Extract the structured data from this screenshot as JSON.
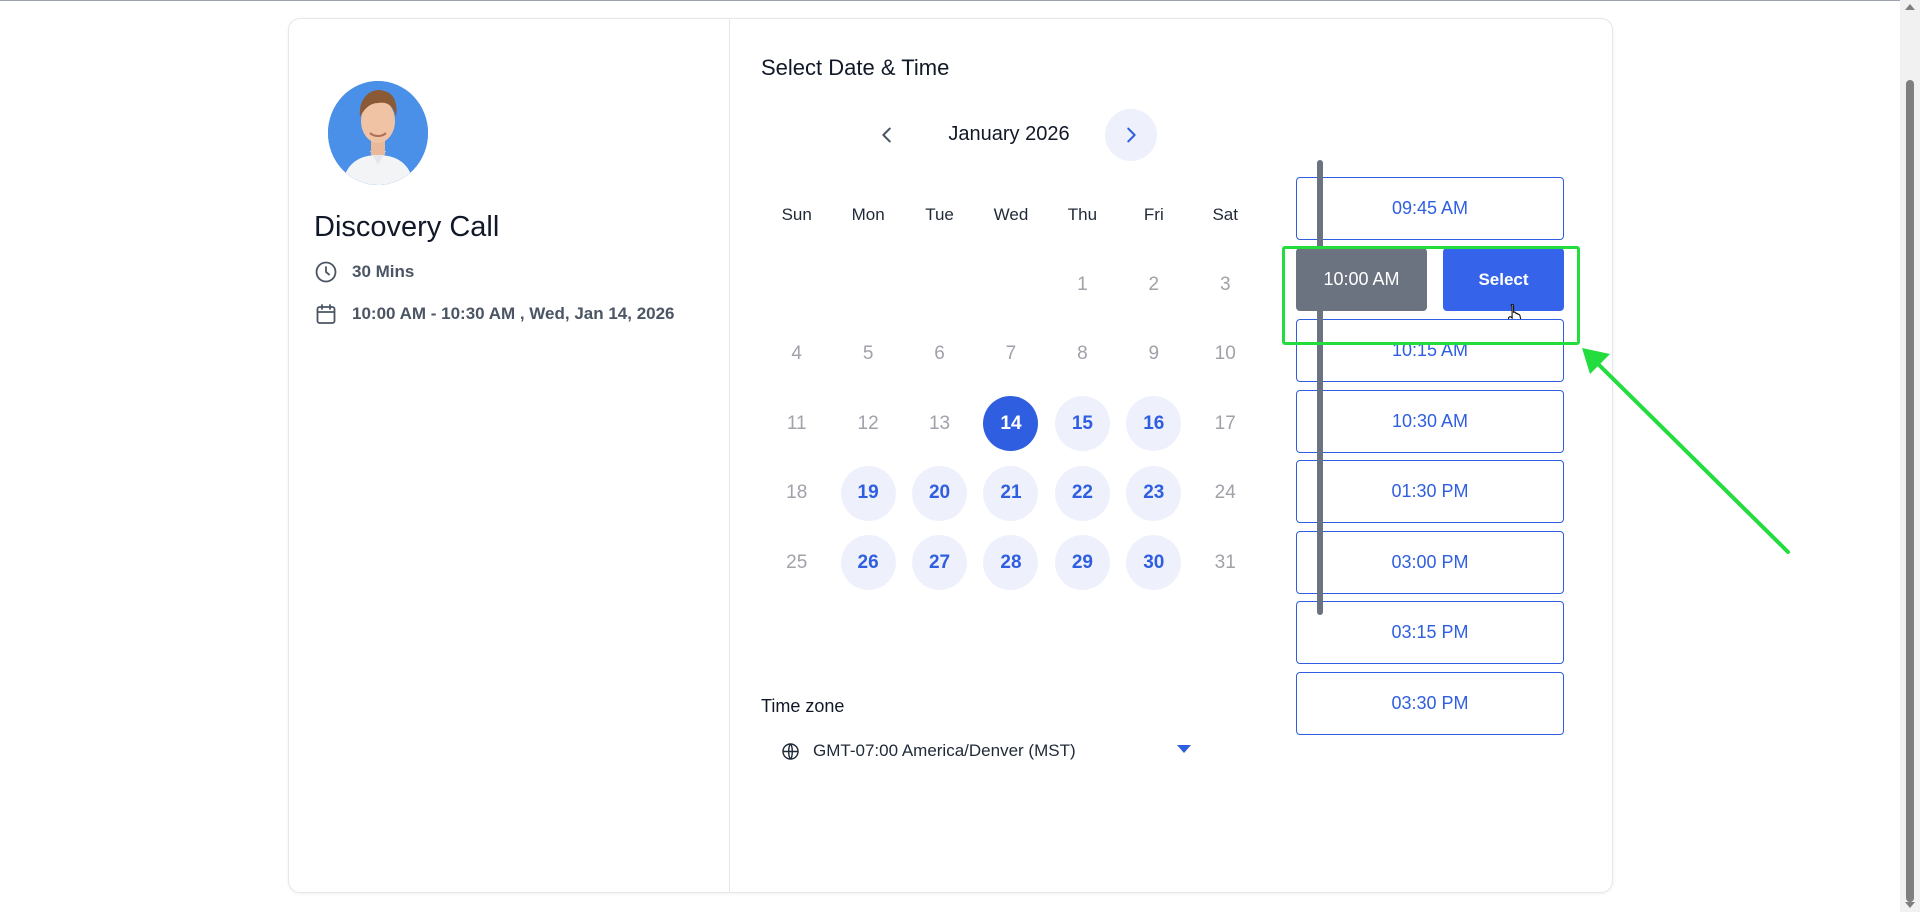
{
  "event": {
    "title": "Discovery Call",
    "duration": "30 Mins",
    "selected_range": "10:00 AM - 10:30 AM , Wed, Jan 14, 2026",
    "duration_icon": "clock-icon",
    "date_icon": "calendar-icon"
  },
  "booking": {
    "heading": "Select Date & Time",
    "month_label": "January 2026",
    "weekdays": [
      "Sun",
      "Mon",
      "Tue",
      "Wed",
      "Thu",
      "Fri",
      "Sat"
    ],
    "weeks": [
      [
        {
          "d": ""
        },
        {
          "d": ""
        },
        {
          "d": ""
        },
        {
          "d": ""
        },
        {
          "d": "1",
          "s": "off"
        },
        {
          "d": "2",
          "s": "off"
        },
        {
          "d": "3",
          "s": "off"
        }
      ],
      [
        {
          "d": "4",
          "s": "off"
        },
        {
          "d": "5",
          "s": "off"
        },
        {
          "d": "6",
          "s": "off"
        },
        {
          "d": "7",
          "s": "off"
        },
        {
          "d": "8",
          "s": "off"
        },
        {
          "d": "9",
          "s": "off"
        },
        {
          "d": "10",
          "s": "off"
        }
      ],
      [
        {
          "d": "11",
          "s": "off"
        },
        {
          "d": "12",
          "s": "off"
        },
        {
          "d": "13",
          "s": "off"
        },
        {
          "d": "14",
          "s": "selected"
        },
        {
          "d": "15",
          "s": "avail"
        },
        {
          "d": "16",
          "s": "avail"
        },
        {
          "d": "17",
          "s": "off"
        }
      ],
      [
        {
          "d": "18",
          "s": "off"
        },
        {
          "d": "19",
          "s": "avail"
        },
        {
          "d": "20",
          "s": "avail"
        },
        {
          "d": "21",
          "s": "avail"
        },
        {
          "d": "22",
          "s": "avail"
        },
        {
          "d": "23",
          "s": "avail"
        },
        {
          "d": "24",
          "s": "off"
        }
      ],
      [
        {
          "d": "25",
          "s": "off"
        },
        {
          "d": "26",
          "s": "avail"
        },
        {
          "d": "27",
          "s": "avail"
        },
        {
          "d": "28",
          "s": "avail"
        },
        {
          "d": "29",
          "s": "avail"
        },
        {
          "d": "30",
          "s": "avail"
        },
        {
          "d": "31",
          "s": "off"
        }
      ]
    ],
    "timezone_label": "Time zone",
    "timezone_value": "GMT-07:00 America/Denver (MST)",
    "time_slots": [
      "09:45 AM",
      "10:00 AM",
      "10:15 AM",
      "10:30 AM",
      "01:30 PM",
      "03:00 PM",
      "03:15 PM",
      "03:30 PM"
    ],
    "picked_slot_index": 1,
    "select_button_label": "Select"
  },
  "colors": {
    "accent": "#2f5fe0",
    "available_bg": "#eef1fb",
    "picked_slot_bg": "#6b7280",
    "annotation": "#22dd3d"
  }
}
